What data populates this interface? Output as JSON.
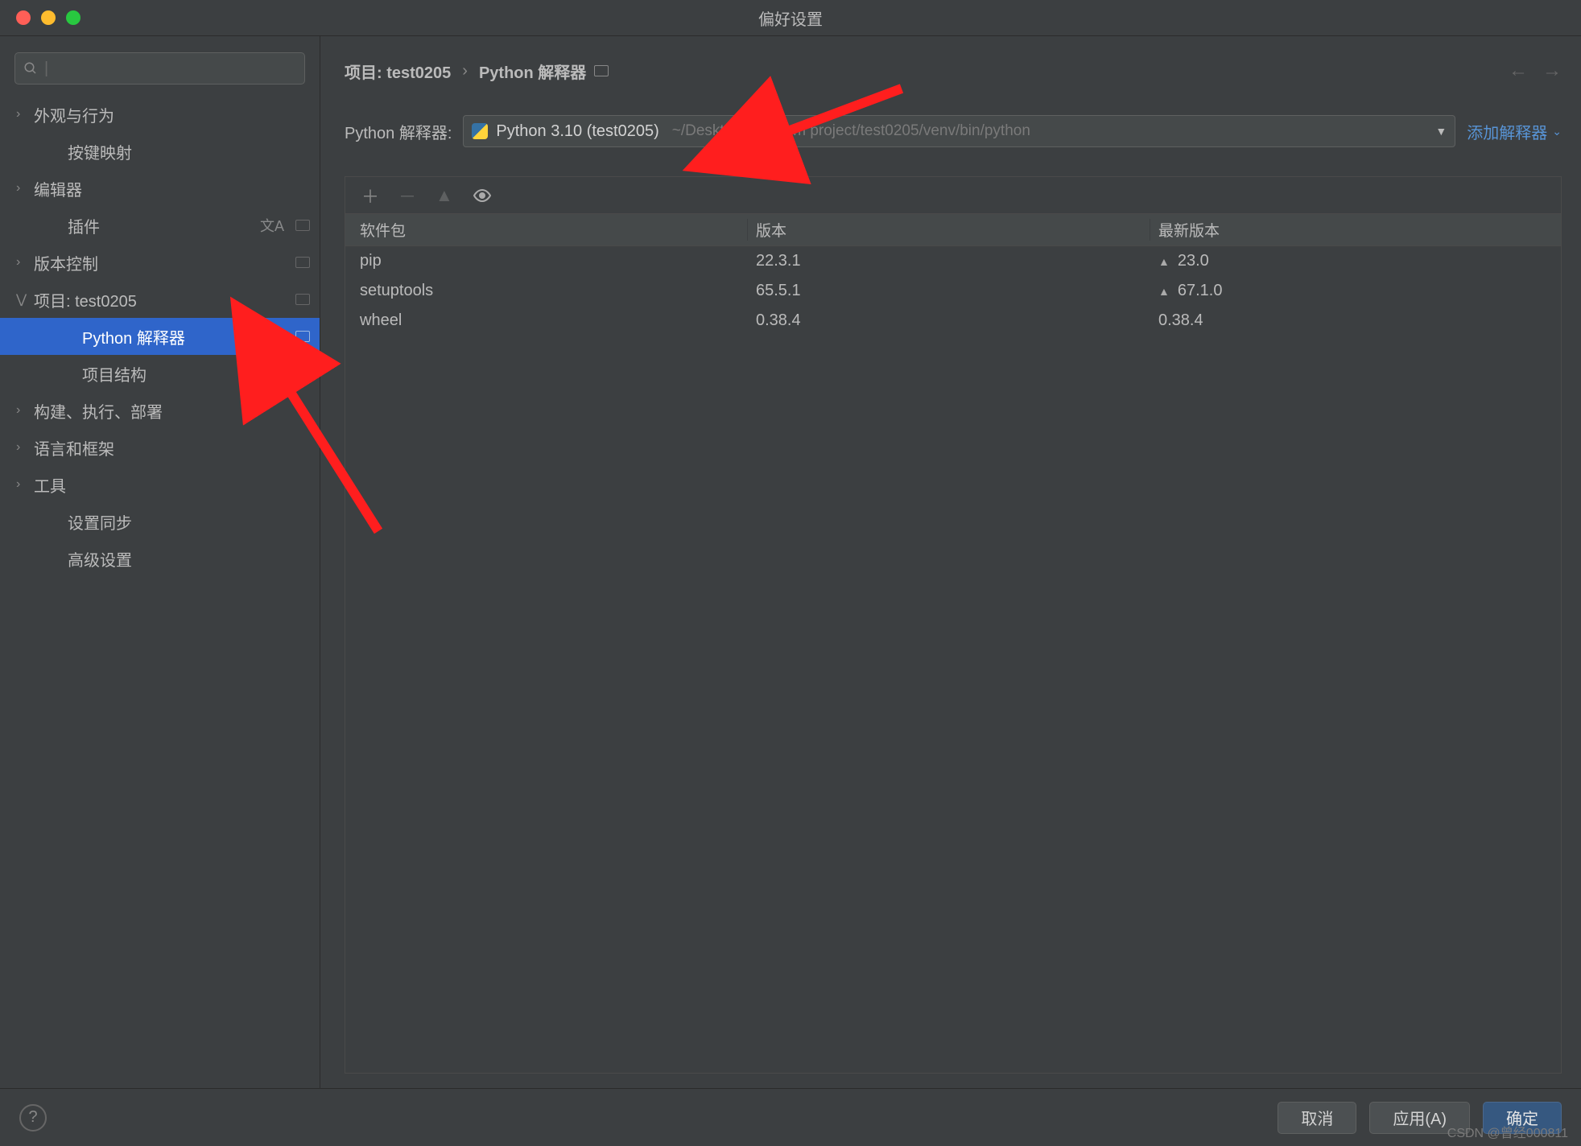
{
  "title": "偏好设置",
  "search_placeholder": "",
  "sidebar": {
    "items": [
      {
        "label": "外观与行为",
        "expandable": true,
        "level": 0
      },
      {
        "label": "按键映射",
        "expandable": false,
        "level": 1
      },
      {
        "label": "编辑器",
        "expandable": true,
        "level": 0
      },
      {
        "label": "插件",
        "expandable": false,
        "level": 1,
        "lang_icon": true,
        "proj_icon": true
      },
      {
        "label": "版本控制",
        "expandable": true,
        "level": 0,
        "proj_icon": true
      },
      {
        "label": "项目: test0205",
        "expandable": true,
        "level": 0,
        "expanded": true,
        "proj_icon": true
      },
      {
        "label": "Python 解释器",
        "expandable": false,
        "level": 2,
        "proj_icon": true,
        "selected": true
      },
      {
        "label": "项目结构",
        "expandable": false,
        "level": 2,
        "proj_icon": true
      },
      {
        "label": "构建、执行、部署",
        "expandable": true,
        "level": 0
      },
      {
        "label": "语言和框架",
        "expandable": true,
        "level": 0
      },
      {
        "label": "工具",
        "expandable": true,
        "level": 0
      },
      {
        "label": "设置同步",
        "expandable": false,
        "level": 1
      },
      {
        "label": "高级设置",
        "expandable": false,
        "level": 1
      }
    ]
  },
  "breadcrumb": {
    "root": "项目: test0205",
    "leaf": "Python 解释器"
  },
  "interpreter": {
    "label": "Python 解释器:",
    "name": "Python 3.10 (test0205)",
    "path": "~/Desktop/Pycharm project/test0205/venv/bin/python",
    "add_label": "添加解释器"
  },
  "packages": {
    "headers": {
      "name": "软件包",
      "version": "版本",
      "latest": "最新版本"
    },
    "rows": [
      {
        "name": "pip",
        "version": "22.3.1",
        "latest": "23.0",
        "upgrade": true
      },
      {
        "name": "setuptools",
        "version": "65.5.1",
        "latest": "67.1.0",
        "upgrade": true
      },
      {
        "name": "wheel",
        "version": "0.38.4",
        "latest": "0.38.4",
        "upgrade": false
      }
    ]
  },
  "footer": {
    "cancel": "取消",
    "apply": "应用(A)",
    "ok": "确定"
  },
  "watermark": "CSDN @曾经000811"
}
